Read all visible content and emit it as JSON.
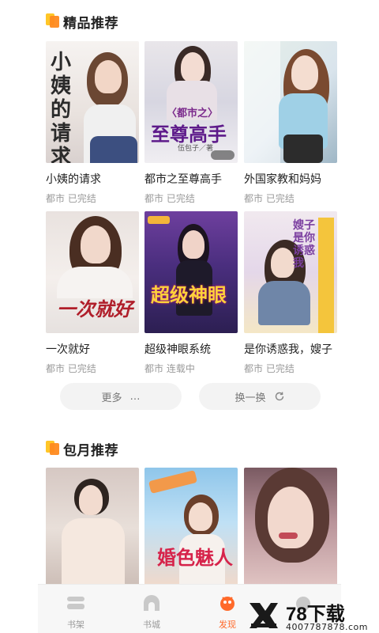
{
  "sections": {
    "featured_title": "精品推荐",
    "monthly_title": "包月推荐"
  },
  "featured_books": [
    {
      "name": "小姨的请求",
      "meta": "都市 已完结",
      "cover_text": "小姨的请求"
    },
    {
      "name": "都市之至尊高手",
      "meta": "都市 已完结",
      "cover_text": "至尊高手",
      "cover_sub": "〈都市之〉",
      "cover_author": "伍包子／著"
    },
    {
      "name": "外国家教和妈妈",
      "meta": "都市 已完结"
    },
    {
      "name": "一次就好",
      "meta": "都市 已完结",
      "cover_text": "一次就好"
    },
    {
      "name": "超级神眼系统",
      "meta": "都市 连载中",
      "cover_text": "超级神眼"
    },
    {
      "name": "是你诱惑我，嫂子",
      "meta": "都市 已完结",
      "cover_text": "嫂子 是你诱惑我"
    }
  ],
  "actions": {
    "more_label": "更多",
    "more_icon": "…",
    "refresh_label": "换一换"
  },
  "monthly_books": [
    {
      "cover_text": ""
    },
    {
      "cover_text": "婚色魅人"
    },
    {
      "cover_text": ""
    }
  ],
  "tabbar": {
    "items": [
      {
        "label": "书架"
      },
      {
        "label": "书城"
      },
      {
        "label": "发现",
        "active": true
      },
      {
        "label": ""
      }
    ]
  },
  "watermark": {
    "brand": "78下载",
    "url": "4007787878.com"
  },
  "colors": {
    "accent": "#ff6a2a",
    "title_icon_a": "#ffc627",
    "title_icon_b": "#ff8a1f"
  }
}
